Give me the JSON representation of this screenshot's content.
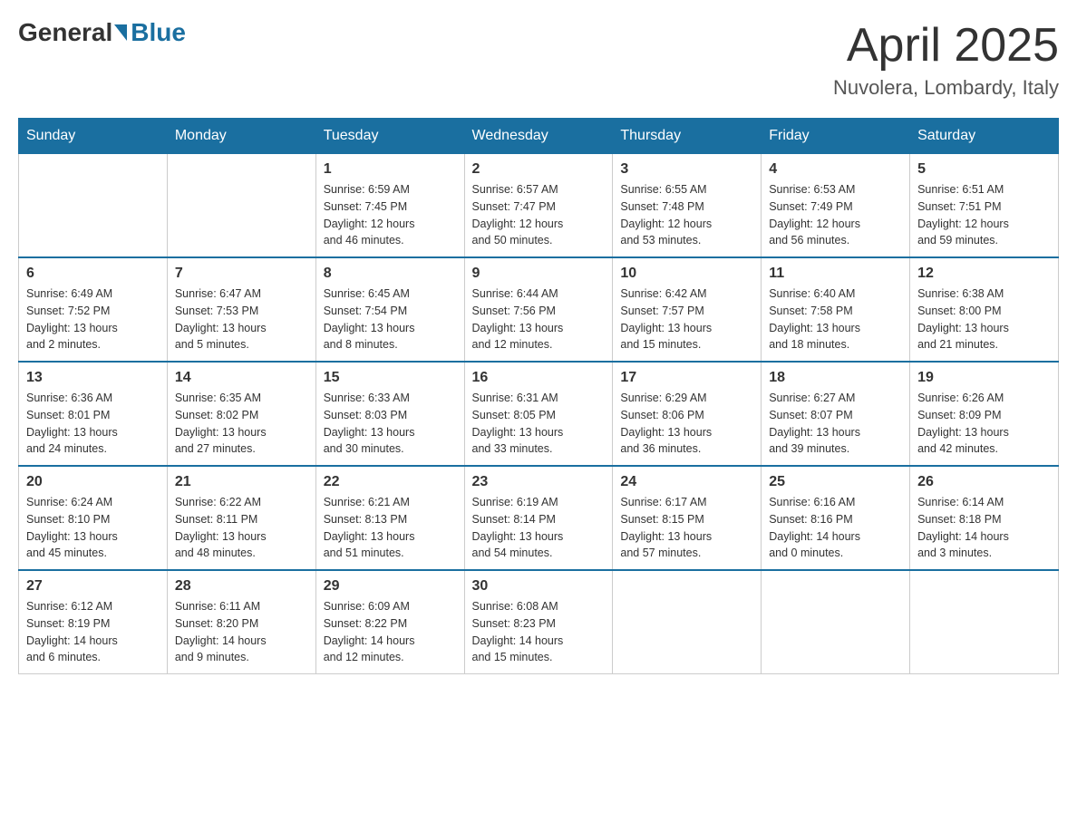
{
  "header": {
    "logo_general": "General",
    "logo_blue": "Blue",
    "title": "April 2025",
    "location": "Nuvolera, Lombardy, Italy"
  },
  "weekdays": [
    "Sunday",
    "Monday",
    "Tuesday",
    "Wednesday",
    "Thursday",
    "Friday",
    "Saturday"
  ],
  "weeks": [
    [
      {
        "day": "",
        "info": ""
      },
      {
        "day": "",
        "info": ""
      },
      {
        "day": "1",
        "info": "Sunrise: 6:59 AM\nSunset: 7:45 PM\nDaylight: 12 hours\nand 46 minutes."
      },
      {
        "day": "2",
        "info": "Sunrise: 6:57 AM\nSunset: 7:47 PM\nDaylight: 12 hours\nand 50 minutes."
      },
      {
        "day": "3",
        "info": "Sunrise: 6:55 AM\nSunset: 7:48 PM\nDaylight: 12 hours\nand 53 minutes."
      },
      {
        "day": "4",
        "info": "Sunrise: 6:53 AM\nSunset: 7:49 PM\nDaylight: 12 hours\nand 56 minutes."
      },
      {
        "day": "5",
        "info": "Sunrise: 6:51 AM\nSunset: 7:51 PM\nDaylight: 12 hours\nand 59 minutes."
      }
    ],
    [
      {
        "day": "6",
        "info": "Sunrise: 6:49 AM\nSunset: 7:52 PM\nDaylight: 13 hours\nand 2 minutes."
      },
      {
        "day": "7",
        "info": "Sunrise: 6:47 AM\nSunset: 7:53 PM\nDaylight: 13 hours\nand 5 minutes."
      },
      {
        "day": "8",
        "info": "Sunrise: 6:45 AM\nSunset: 7:54 PM\nDaylight: 13 hours\nand 8 minutes."
      },
      {
        "day": "9",
        "info": "Sunrise: 6:44 AM\nSunset: 7:56 PM\nDaylight: 13 hours\nand 12 minutes."
      },
      {
        "day": "10",
        "info": "Sunrise: 6:42 AM\nSunset: 7:57 PM\nDaylight: 13 hours\nand 15 minutes."
      },
      {
        "day": "11",
        "info": "Sunrise: 6:40 AM\nSunset: 7:58 PM\nDaylight: 13 hours\nand 18 minutes."
      },
      {
        "day": "12",
        "info": "Sunrise: 6:38 AM\nSunset: 8:00 PM\nDaylight: 13 hours\nand 21 minutes."
      }
    ],
    [
      {
        "day": "13",
        "info": "Sunrise: 6:36 AM\nSunset: 8:01 PM\nDaylight: 13 hours\nand 24 minutes."
      },
      {
        "day": "14",
        "info": "Sunrise: 6:35 AM\nSunset: 8:02 PM\nDaylight: 13 hours\nand 27 minutes."
      },
      {
        "day": "15",
        "info": "Sunrise: 6:33 AM\nSunset: 8:03 PM\nDaylight: 13 hours\nand 30 minutes."
      },
      {
        "day": "16",
        "info": "Sunrise: 6:31 AM\nSunset: 8:05 PM\nDaylight: 13 hours\nand 33 minutes."
      },
      {
        "day": "17",
        "info": "Sunrise: 6:29 AM\nSunset: 8:06 PM\nDaylight: 13 hours\nand 36 minutes."
      },
      {
        "day": "18",
        "info": "Sunrise: 6:27 AM\nSunset: 8:07 PM\nDaylight: 13 hours\nand 39 minutes."
      },
      {
        "day": "19",
        "info": "Sunrise: 6:26 AM\nSunset: 8:09 PM\nDaylight: 13 hours\nand 42 minutes."
      }
    ],
    [
      {
        "day": "20",
        "info": "Sunrise: 6:24 AM\nSunset: 8:10 PM\nDaylight: 13 hours\nand 45 minutes."
      },
      {
        "day": "21",
        "info": "Sunrise: 6:22 AM\nSunset: 8:11 PM\nDaylight: 13 hours\nand 48 minutes."
      },
      {
        "day": "22",
        "info": "Sunrise: 6:21 AM\nSunset: 8:13 PM\nDaylight: 13 hours\nand 51 minutes."
      },
      {
        "day": "23",
        "info": "Sunrise: 6:19 AM\nSunset: 8:14 PM\nDaylight: 13 hours\nand 54 minutes."
      },
      {
        "day": "24",
        "info": "Sunrise: 6:17 AM\nSunset: 8:15 PM\nDaylight: 13 hours\nand 57 minutes."
      },
      {
        "day": "25",
        "info": "Sunrise: 6:16 AM\nSunset: 8:16 PM\nDaylight: 14 hours\nand 0 minutes."
      },
      {
        "day": "26",
        "info": "Sunrise: 6:14 AM\nSunset: 8:18 PM\nDaylight: 14 hours\nand 3 minutes."
      }
    ],
    [
      {
        "day": "27",
        "info": "Sunrise: 6:12 AM\nSunset: 8:19 PM\nDaylight: 14 hours\nand 6 minutes."
      },
      {
        "day": "28",
        "info": "Sunrise: 6:11 AM\nSunset: 8:20 PM\nDaylight: 14 hours\nand 9 minutes."
      },
      {
        "day": "29",
        "info": "Sunrise: 6:09 AM\nSunset: 8:22 PM\nDaylight: 14 hours\nand 12 minutes."
      },
      {
        "day": "30",
        "info": "Sunrise: 6:08 AM\nSunset: 8:23 PM\nDaylight: 14 hours\nand 15 minutes."
      },
      {
        "day": "",
        "info": ""
      },
      {
        "day": "",
        "info": ""
      },
      {
        "day": "",
        "info": ""
      }
    ]
  ]
}
